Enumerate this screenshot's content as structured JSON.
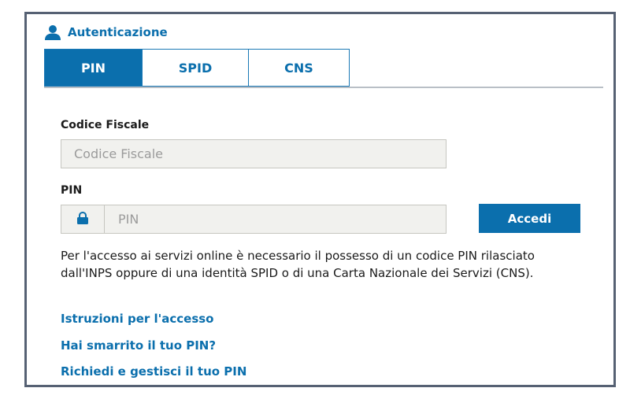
{
  "header": {
    "title": "Autenticazione",
    "icon": "user-icon"
  },
  "tabs": [
    {
      "label": "PIN",
      "active": true
    },
    {
      "label": "SPID",
      "active": false
    },
    {
      "label": "CNS",
      "active": false
    }
  ],
  "form": {
    "codice_fiscale": {
      "label": "Codice Fiscale",
      "placeholder": "Codice Fiscale",
      "value": ""
    },
    "pin": {
      "label": "PIN",
      "placeholder": "PIN",
      "value": "",
      "icon": "lock-icon"
    },
    "submit_label": "Accedi"
  },
  "info_text": "Per l'accesso ai servizi online è necessario il possesso di un codice PIN rilasciato dall'INPS oppure di una identità SPID o di una Carta Nazionale dei Servizi (CNS).",
  "links": [
    {
      "label": "Istruzioni per l'accesso"
    },
    {
      "label": "Hai smarrito il tuo PIN?"
    },
    {
      "label": "Richiedi e gestisci il tuo PIN"
    }
  ],
  "colors": {
    "accent": "#0b6fad",
    "border": "#566173",
    "input_bg": "#f1f1ee"
  }
}
